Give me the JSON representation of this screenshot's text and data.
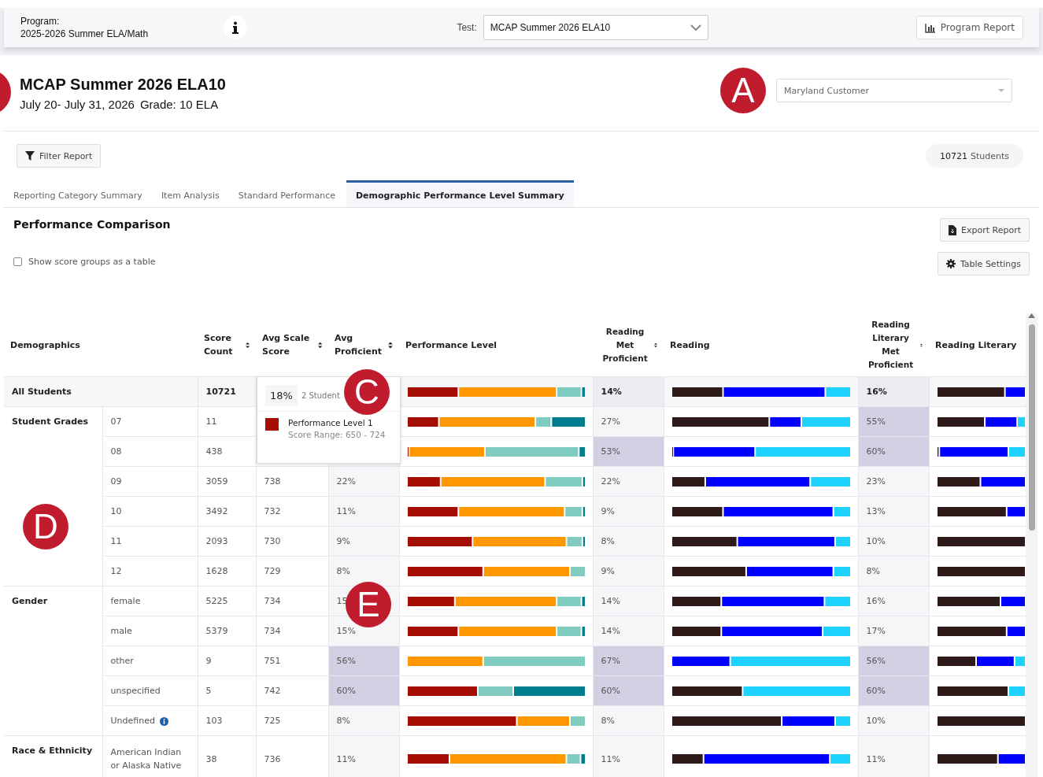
{
  "program": {
    "label": "Program:",
    "value": "2025-2026 Summer ELA/Math"
  },
  "test": {
    "label": "Test:",
    "value": "MCAP Summer 2026 ELA10"
  },
  "program_report_button": "Program Report",
  "report": {
    "title": "MCAP Summer 2026 ELA10",
    "dates": "July 20- July 31, 2026",
    "grade": "Grade: 10 ELA"
  },
  "customer_select": {
    "value": "Maryland Customer"
  },
  "filter_button": "Filter Report",
  "student_count": {
    "value": "10721",
    "label": "Students"
  },
  "tabs": [
    {
      "label": "Reporting Category Summary",
      "selected": false
    },
    {
      "label": "Item Analysis",
      "selected": false
    },
    {
      "label": "Standard Performance",
      "selected": false
    },
    {
      "label": "Demographic Performance Level Summary",
      "selected": true
    }
  ],
  "section_title": "Performance Comparison",
  "export_button": "Export Report",
  "show_table_checkbox": {
    "label": "Show score groups as a table",
    "checked": false
  },
  "table_settings_button": "Table Settings",
  "table": {
    "columns": [
      {
        "label": "Demographics",
        "sortable": false
      },
      {
        "label": "Score Count",
        "sortable": true
      },
      {
        "label": "Avg Scale Score",
        "sortable": true
      },
      {
        "label": "Avg Proficient",
        "sortable": true
      },
      {
        "label": "Performance Level",
        "sortable": false
      },
      {
        "label": "Reading Met Proficient",
        "sortable": true
      },
      {
        "label": "Reading",
        "sortable": false
      },
      {
        "label": "Reading Literary Met Proficient",
        "sortable": true
      },
      {
        "label": "Reading Literary",
        "sortable": false
      }
    ],
    "groups": [
      {
        "label": "All Students",
        "kind": "total",
        "rows": [
          {
            "count": "10721",
            "reading_met": {
              "text": "14%",
              "highlight": false
            },
            "literary_met": {
              "text": "16%",
              "highlight": false
            }
          }
        ]
      },
      {
        "label": "Student Grades",
        "kind": "group",
        "rows": [
          {
            "subgroup": "07",
            "info": false,
            "count": "11",
            "reading_met": {
              "text": "27%",
              "highlight": false
            },
            "literary_met": {
              "text": "55%",
              "highlight": true
            }
          },
          {
            "subgroup": "08",
            "info": false,
            "count": "438",
            "reading_met": {
              "text": "53%",
              "highlight": true
            },
            "literary_met": {
              "text": "60%",
              "highlight": true
            }
          },
          {
            "subgroup": "09",
            "info": false,
            "count": "3059",
            "avg_scale": "738",
            "avg_proficient": {
              "text": "22%",
              "highlight": false
            },
            "reading_met": {
              "text": "22%",
              "highlight": false
            },
            "literary_met": {
              "text": "23%",
              "highlight": false
            }
          },
          {
            "subgroup": "10",
            "info": false,
            "count": "3492",
            "avg_scale": "732",
            "avg_proficient": {
              "text": "11%",
              "highlight": false
            },
            "reading_met": {
              "text": "9%",
              "highlight": false
            },
            "literary_met": {
              "text": "13%",
              "highlight": false
            }
          },
          {
            "subgroup": "11",
            "info": false,
            "count": "2093",
            "avg_scale": "730",
            "avg_proficient": {
              "text": "9%",
              "highlight": false
            },
            "reading_met": {
              "text": "8%",
              "highlight": false
            },
            "literary_met": {
              "text": "10%",
              "highlight": false
            }
          },
          {
            "subgroup": "12",
            "info": false,
            "count": "1628",
            "avg_scale": "729",
            "avg_proficient": {
              "text": "8%",
              "highlight": false
            },
            "reading_met": {
              "text": "9%",
              "highlight": false
            },
            "literary_met": {
              "text": "8%",
              "highlight": false
            }
          }
        ]
      },
      {
        "label": "Gender",
        "kind": "group",
        "rows": [
          {
            "subgroup": "female",
            "info": false,
            "count": "5225",
            "avg_scale": "734",
            "avg_proficient": {
              "text": "15",
              "highlight": false
            },
            "reading_met": {
              "text": "14%",
              "highlight": false
            },
            "literary_met": {
              "text": "16%",
              "highlight": false
            }
          },
          {
            "subgroup": "male",
            "info": false,
            "count": "5379",
            "avg_scale": "734",
            "avg_proficient": {
              "text": "15%",
              "highlight": false
            },
            "reading_met": {
              "text": "14%",
              "highlight": false
            },
            "literary_met": {
              "text": "17%",
              "highlight": false
            }
          },
          {
            "subgroup": "other",
            "info": false,
            "count": "9",
            "avg_scale": "751",
            "avg_proficient": {
              "text": "56%",
              "highlight": true
            },
            "reading_met": {
              "text": "67%",
              "highlight": true
            },
            "literary_met": {
              "text": "56%",
              "highlight": true
            }
          },
          {
            "subgroup": "unspecified",
            "info": false,
            "count": "5",
            "avg_scale": "742",
            "avg_proficient": {
              "text": "60%",
              "highlight": true
            },
            "reading_met": {
              "text": "60%",
              "highlight": true
            },
            "literary_met": {
              "text": "60%",
              "highlight": true
            }
          },
          {
            "subgroup": "Undefined",
            "info": true,
            "count": "103",
            "avg_scale": "725",
            "avg_proficient": {
              "text": "8%",
              "highlight": false
            },
            "reading_met": {
              "text": "8%",
              "highlight": false
            },
            "literary_met": {
              "text": "10%",
              "highlight": false
            }
          }
        ]
      },
      {
        "label": "Race & Ethnicity",
        "kind": "group",
        "rows": [
          {
            "subgroup": "American Indian or Alaska Native",
            "info": false,
            "count": "38",
            "avg_scale": "736",
            "avg_proficient": {
              "text": "11%",
              "highlight": false
            },
            "reading_met": {
              "text": "11%",
              "highlight": false
            },
            "literary_met": {
              "text": "11%",
              "highlight": false
            }
          }
        ]
      }
    ]
  },
  "tooltip": {
    "percent": "18%",
    "count": "2 Student",
    "level_name": "Performance Level 1",
    "range": "Score Range: 650 - 724",
    "color": "#a80d05"
  },
  "callouts": [
    {
      "letter": "A"
    },
    {
      "letter": "C"
    },
    {
      "letter": "D"
    },
    {
      "letter": "E"
    }
  ]
}
